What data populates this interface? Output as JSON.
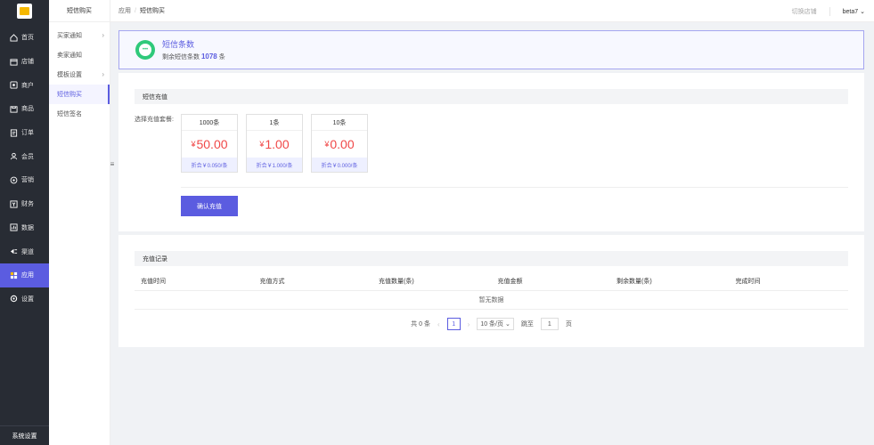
{
  "nav": {
    "items": [
      {
        "label": "首页",
        "icon": "home-icon"
      },
      {
        "label": "店铺",
        "icon": "store-icon"
      },
      {
        "label": "商户",
        "icon": "merchant-icon"
      },
      {
        "label": "商品",
        "icon": "product-icon"
      },
      {
        "label": "订单",
        "icon": "order-icon"
      },
      {
        "label": "会员",
        "icon": "member-icon"
      },
      {
        "label": "营销",
        "icon": "marketing-icon"
      },
      {
        "label": "财务",
        "icon": "finance-icon"
      },
      {
        "label": "数据",
        "icon": "data-icon"
      },
      {
        "label": "渠道",
        "icon": "channel-icon"
      },
      {
        "label": "应用",
        "icon": "app-icon"
      },
      {
        "label": "设置",
        "icon": "settings-icon"
      }
    ],
    "active_index": 10,
    "footer": "系统设置"
  },
  "subnav": {
    "title": "短信购买",
    "items": [
      {
        "label": "买家通知",
        "has_arrow": true
      },
      {
        "label": "卖家通知",
        "has_arrow": false
      },
      {
        "label": "模板设置",
        "has_arrow": true
      },
      {
        "label": "短信购买",
        "has_arrow": false
      },
      {
        "label": "短信签名",
        "has_arrow": false
      }
    ],
    "active_index": 3
  },
  "header": {
    "breadcrumb": [
      "应用",
      "短信购买"
    ],
    "switch_shop": "切换店铺",
    "user": "beta7"
  },
  "banner": {
    "title": "短信条数",
    "sub_prefix": "剩余短信条数",
    "count": "1078",
    "sub_suffix": "条"
  },
  "recharge": {
    "heading": "短信充值",
    "pick_label": "选择充值套餐:",
    "currency": "¥",
    "packages": [
      {
        "name": "1000条",
        "price": "50.00",
        "discount": "折合￥0.050/条"
      },
      {
        "name": "1条",
        "price": "1.00",
        "discount": "折合￥1.000/条"
      },
      {
        "name": "10条",
        "price": "0.00",
        "discount": "折合￥0.000/条"
      }
    ],
    "confirm_label": "确认充值"
  },
  "records": {
    "heading": "充值记录",
    "columns": [
      "充值时间",
      "充值方式",
      "充值数量(条)",
      "充值金额",
      "剩余数量(条)",
      "完成时间"
    ],
    "empty_text": "暂无数据",
    "pager": {
      "total_text": "共 0 条",
      "current_page": "1",
      "page_size": "10 条/页",
      "goto_label": "跳至",
      "goto_value": "1",
      "page_unit": "页"
    }
  },
  "colors": {
    "accent": "#5b5ce0",
    "price": "#f04848",
    "success": "#2fc97a",
    "sidebar": "#282c34"
  }
}
